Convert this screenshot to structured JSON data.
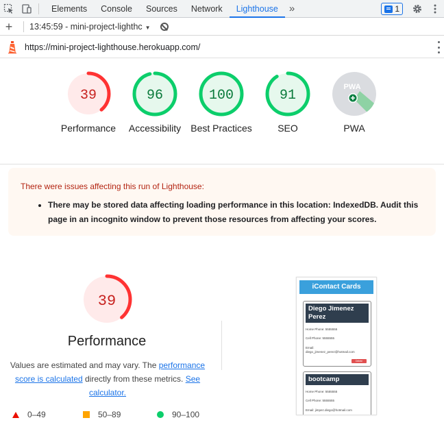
{
  "devtools": {
    "tabs": [
      "Elements",
      "Console",
      "Sources",
      "Network",
      "Lighthouse"
    ],
    "active_tab": "Lighthouse",
    "more": "»",
    "issues_count": "1"
  },
  "toolbar": {
    "add": "+",
    "run_label": "13:45:59 - mini-project-lighthc"
  },
  "url": "https://mini-project-lighthouse.herokuapp.com/",
  "colors": {
    "fail": "#ff3333",
    "average": "#ffa400",
    "pass": "#0cce6b",
    "pwa_gray": "#dadce0"
  },
  "gauges": [
    {
      "score": 39,
      "display": "39",
      "label": "Performance",
      "status": "fail"
    },
    {
      "score": 96,
      "display": "96",
      "label": "Accessibility",
      "status": "pass"
    },
    {
      "score": 100,
      "display": "100",
      "label": "Best Practices",
      "status": "pass"
    },
    {
      "score": 91,
      "display": "91",
      "label": "SEO",
      "status": "pass"
    },
    {
      "label": "PWA",
      "badge_text": "PWA",
      "icon": "pwa-badge-icon"
    }
  ],
  "warning": {
    "title": "There were issues affecting this run of Lighthouse:",
    "items": [
      "There may be stored data affecting loading performance in this location: IndexedDB. Audit this page in an incognito window to prevent those resources from affecting your scores."
    ]
  },
  "performance": {
    "score": 39,
    "display": "39",
    "title": "Performance",
    "desc_prefix": "Values are estimated and may vary. The ",
    "link1": "performance score is calculated",
    "desc_mid": " directly from these metrics. ",
    "link2": "See calculator."
  },
  "legend": [
    {
      "shape": "triangle",
      "range": "0–49"
    },
    {
      "shape": "square",
      "range": "50–89"
    },
    {
      "shape": "circle",
      "range": "90–100"
    }
  ],
  "thumbnail": {
    "header": "iContact Cards",
    "cards": [
      {
        "name": "Diego Jimenez Perez",
        "home": "Home Phone: 5555555",
        "cell": "Cell Phone: 5555555",
        "email_label": "Email:",
        "email": "diego_jimenez_perez@hotmail.com",
        "delete": "Delete"
      },
      {
        "name": "bootcamp",
        "home": "Home Phone: 5555555",
        "cell": "Cell Phone: 5555555",
        "email": "Email: jimpez.diego@hotmail.com"
      }
    ]
  }
}
